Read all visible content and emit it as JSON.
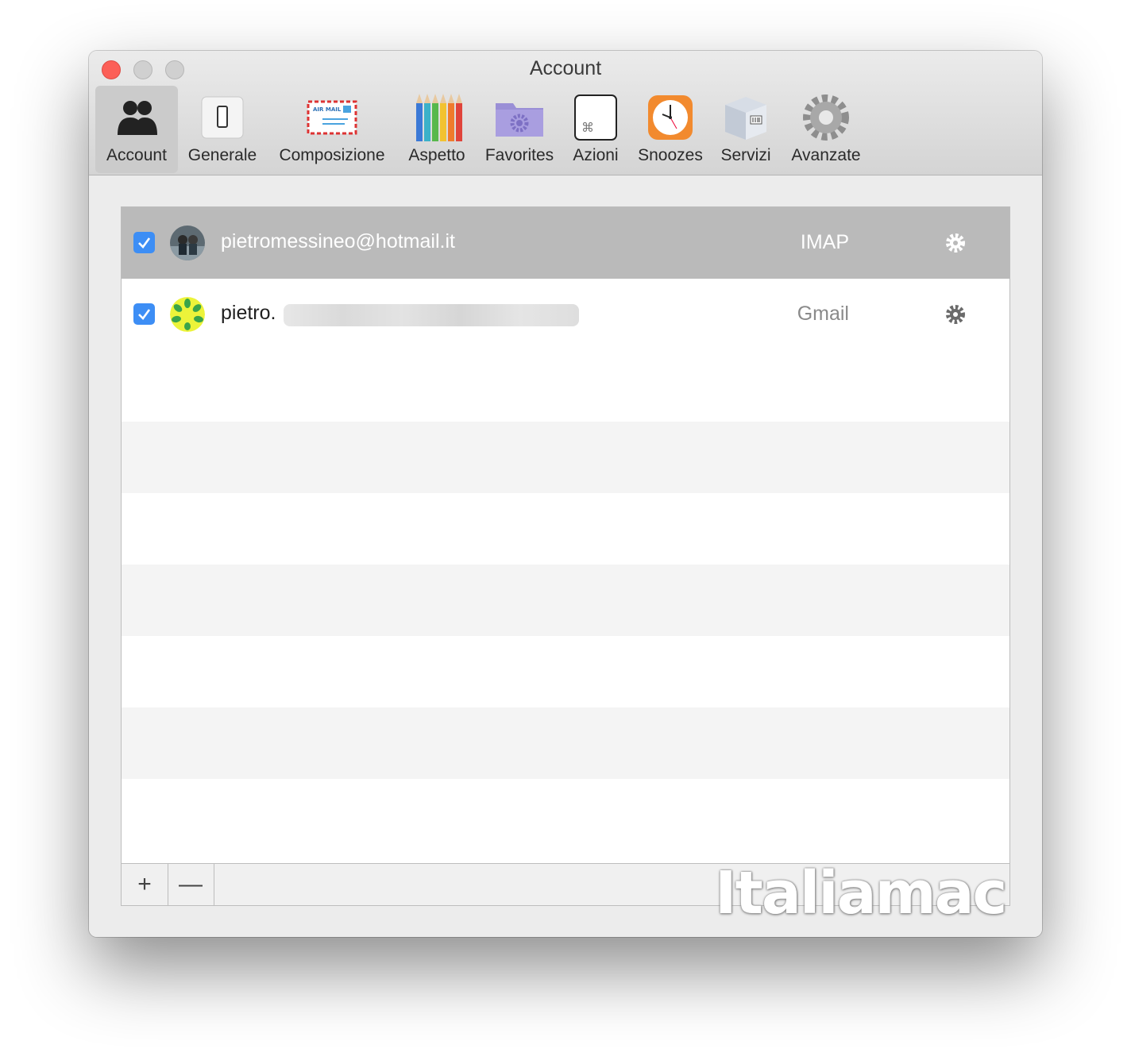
{
  "window": {
    "title": "Account"
  },
  "toolbar": {
    "items": [
      {
        "label": "Account",
        "icon": "accounts-icon",
        "active": true
      },
      {
        "label": "Generale",
        "icon": "switch-icon"
      },
      {
        "label": "Composizione",
        "icon": "airmail-envelope-icon"
      },
      {
        "label": "Aspetto",
        "icon": "pencils-icon"
      },
      {
        "label": "Favorites",
        "icon": "folder-gear-icon"
      },
      {
        "label": "Azioni",
        "icon": "command-key-icon"
      },
      {
        "label": "Snoozes",
        "icon": "clock-icon"
      },
      {
        "label": "Servizi",
        "icon": "package-icon"
      },
      {
        "label": "Avanzate",
        "icon": "gear-icon"
      }
    ]
  },
  "accounts": [
    {
      "email": "pietromessineo@hotmail.it",
      "type": "IMAP",
      "enabled": true,
      "selected": true
    },
    {
      "email": "pietro.",
      "type": "Gmail",
      "enabled": true,
      "selected": false
    }
  ],
  "bottombar": {
    "add_label": "+",
    "remove_label": "—"
  },
  "watermark": "Italiamac",
  "colors": {
    "accent": "#3d8ef5",
    "selection": "#bababa",
    "close": "#fc5f57"
  }
}
